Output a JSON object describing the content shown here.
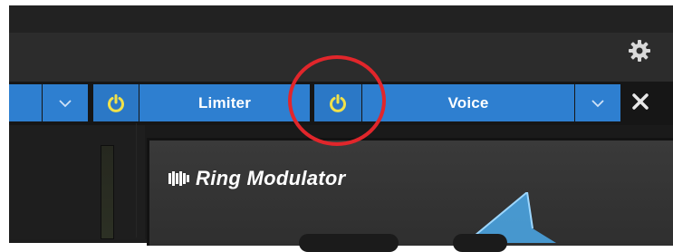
{
  "effects_strip": {
    "slot_1": {
      "power_icon": "power-icon",
      "label": "Limiter",
      "power_color": "#f0e14a"
    },
    "slot_2": {
      "power_icon": "power-icon",
      "label": "Voice",
      "power_color": "#f0e14a"
    },
    "dropdown_icon": "chevron-down-icon",
    "close_icon": "close-icon",
    "slot_color": "#2e7fd0"
  },
  "toolbar": {
    "settings_icon": "gear-icon"
  },
  "plugin": {
    "title": "Ring Modulator",
    "logo": "presonus-logo"
  },
  "annotation": {
    "highlight_color": "#e1262b"
  }
}
